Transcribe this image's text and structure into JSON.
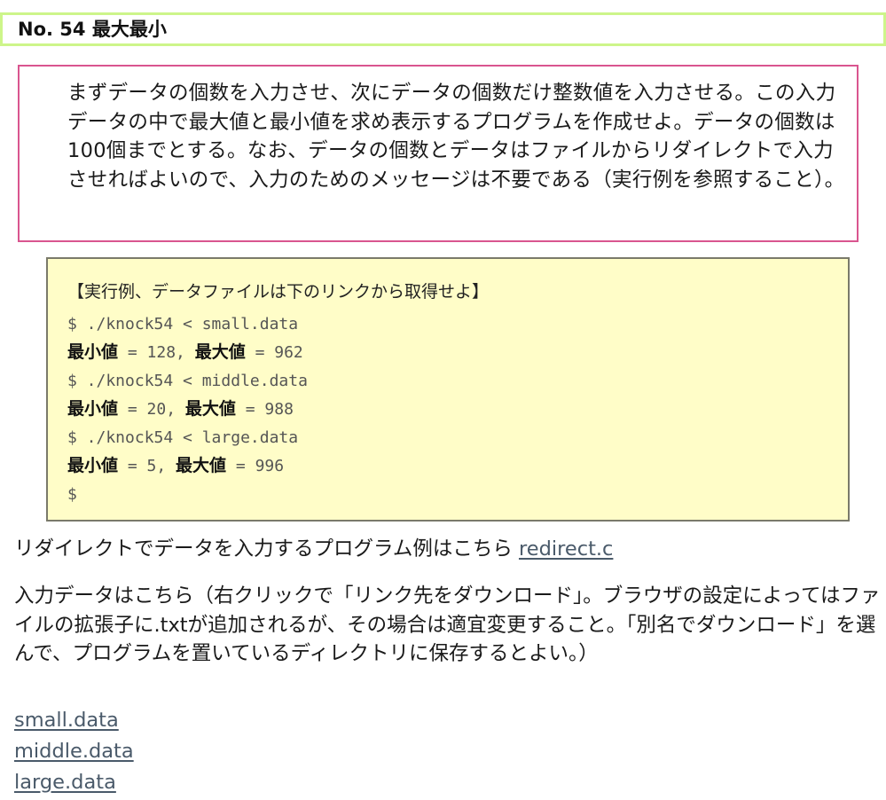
{
  "title": "No. 54 最大最小",
  "problem": {
    "text": "まずデータの個数を入力させ、次にデータの個数だけ整数値を入力させる。この入力データの中で最大値と最小値を求め表示するプログラムを作成せよ。データの個数は100個までとする。なお、データの個数とデータはファイルからリダイレクトで入力させればよいので、入力のためのメッセージは不要である（実行例を参照すること）。"
  },
  "example": {
    "heading": "【実行例、データファイルは下のリンクから取得せよ】",
    "runs": [
      {
        "command": "$ ./knock54 < small.data",
        "min_label": "最小値",
        "min_value": " = 128, ",
        "max_label": "最大値",
        "max_value": " = 962"
      },
      {
        "command": "$ ./knock54 < middle.data",
        "min_label": "最小値",
        "min_value": " = 20, ",
        "max_label": "最大値",
        "max_value": " = 988"
      },
      {
        "command": "$ ./knock54 < large.data",
        "min_label": "最小値",
        "min_value": " = 5, ",
        "max_label": "最大値",
        "max_value": " = 996"
      }
    ],
    "prompt": "$"
  },
  "redirect_note": {
    "text": "リダイレクトでデータを入力するプログラム例はこちら ",
    "link": "redirect.c"
  },
  "input_note": {
    "text": "入力データはこちら（右クリックで「リンク先をダウンロード」。ブラウザの設定によってはファイルの拡張子に.txtが追加されるが、その場合は適宜変更すること。「別名でダウンロード」を選んで、プログラムを置いているディレクトリに保存するとよい。）"
  },
  "data_links": [
    "small.data",
    "middle.data",
    "large.data"
  ],
  "colors": {
    "title_border": "#cdf58a",
    "problem_border": "#d9558f",
    "example_bg": "#fffdc8",
    "example_border": "#7a7a6a",
    "link": "#4a5a6a"
  }
}
